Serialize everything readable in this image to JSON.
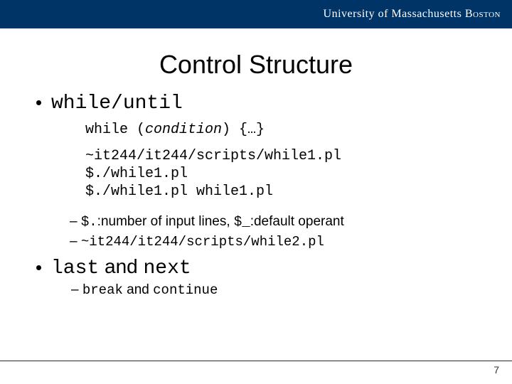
{
  "header": {
    "institution": "University of Massachusetts",
    "campus": "Boston"
  },
  "title": "Control Structure",
  "bullet1": {
    "label": "while/until",
    "syntax_prefix": "while (",
    "syntax_condition": "condition",
    "syntax_suffix": ") {…}",
    "code": [
      "~it244/it244/scripts/while1.pl",
      "$./while1.pl",
      "$./while1.pl while1.pl"
    ],
    "notes": [
      {
        "segments": [
          {
            "t": "$.",
            "style": "mono"
          },
          {
            "t": ":number of input lines, ",
            "style": "sans"
          },
          {
            "t": "$_",
            "style": "mono"
          },
          {
            "t": ":default operant",
            "style": "sans"
          }
        ]
      },
      {
        "segments": [
          {
            "t": "~it244/it244/scripts/while2.pl",
            "style": "mono"
          }
        ]
      }
    ]
  },
  "bullet2": {
    "seg1": "last",
    "seg2": " and ",
    "seg3": "next",
    "sub_seg1": "break",
    "sub_seg2": " and ",
    "sub_seg3": "continue"
  },
  "page_number": "7"
}
